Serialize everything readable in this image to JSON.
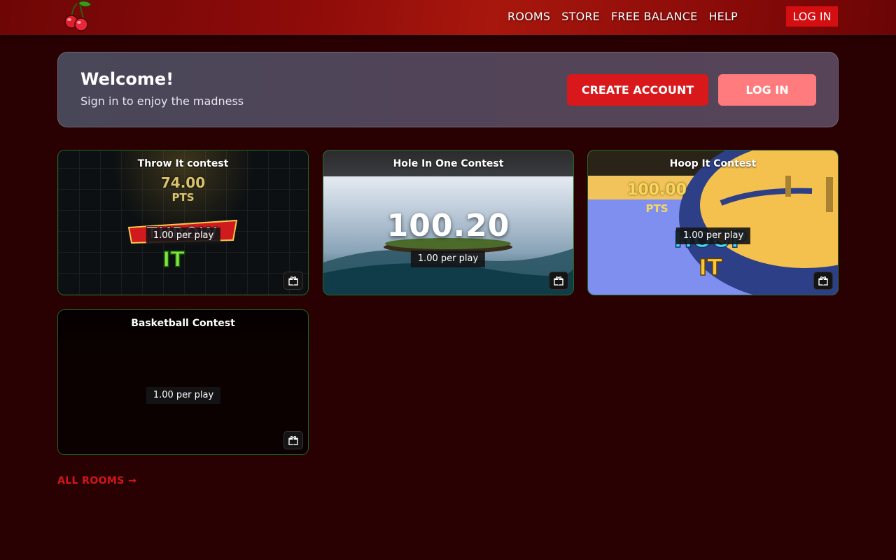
{
  "header": {
    "nav": [
      "ROOMS",
      "STORE",
      "FREE BALANCE",
      "HELP"
    ],
    "login_label": "LOG IN"
  },
  "welcome": {
    "title": "Welcome!",
    "subtitle": "Sign in to enjoy the madness",
    "create_account_label": "CREATE ACCOUNT",
    "login_label": "LOG IN"
  },
  "contests": [
    {
      "title": "Throw It contest",
      "price": "1.00 per play",
      "score": "74.00",
      "score_unit": "PTS",
      "game_logo": [
        "THROW",
        "IT"
      ]
    },
    {
      "title": "Hole In One Contest",
      "price": "1.00 per play",
      "score": "100.20"
    },
    {
      "title": "Hoop It Contest",
      "price": "1.00 per play",
      "score": "100.00",
      "score_unit": "PTS",
      "game_logo": [
        "HOOP",
        "IT"
      ]
    },
    {
      "title": "Basketball Contest",
      "price": "1.00 per play"
    }
  ],
  "all_rooms_label": "ALL ROOMS →",
  "colors": {
    "accent": "#d8181b",
    "accent_light": "#ff7b7d",
    "background": "#2a0102",
    "card_border": "#1f6a23"
  },
  "icons": {
    "logo": "cherry-icon",
    "card_action": "gift-icon"
  }
}
